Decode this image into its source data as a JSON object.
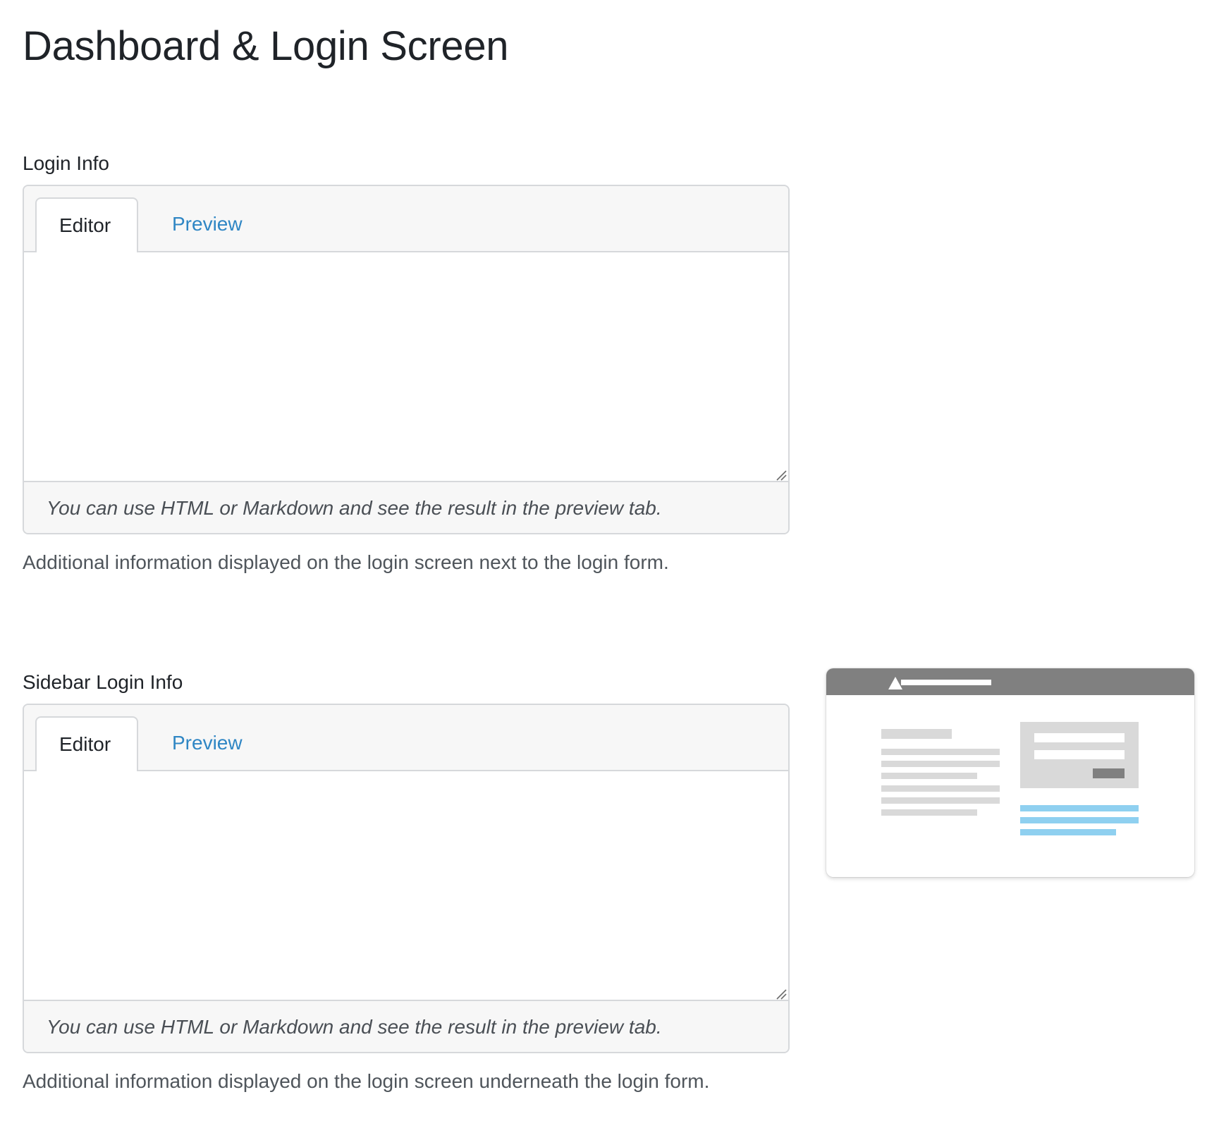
{
  "page": {
    "title": "Dashboard & Login Screen"
  },
  "sections": [
    {
      "label": "Login Info",
      "tabs": {
        "editor": "Editor",
        "preview": "Preview"
      },
      "textarea_value": "",
      "hint": "You can use HTML or Markdown and see the result in the preview tab.",
      "description": "Additional information displayed on the login screen next to the login form."
    },
    {
      "label": "Sidebar Login Info",
      "tabs": {
        "editor": "Editor",
        "preview": "Preview"
      },
      "textarea_value": "",
      "hint": "You can use HTML or Markdown and see the result in the preview tab.",
      "description": "Additional information displayed on the login screen underneath the login form."
    }
  ],
  "colors": {
    "tab_active_text": "#1f2328",
    "tab_link_text": "#2f86c4",
    "illustration_header": "#808080",
    "illustration_lines": "#d9d9d9",
    "illustration_links": "#8fd0f0"
  },
  "icons": {
    "resize_handle": "resize-grip-icon",
    "illustration_logo": "triangle-logo-icon"
  }
}
